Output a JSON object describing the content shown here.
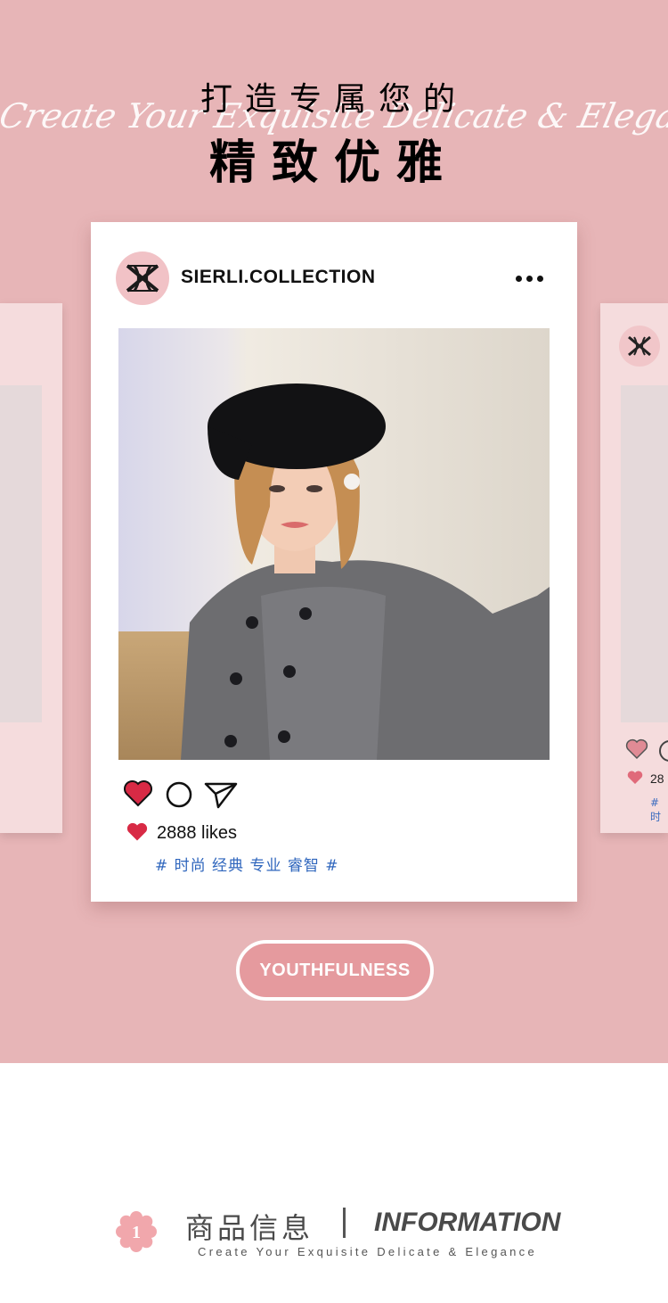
{
  "header": {
    "title_line1": "打造专属您的",
    "title_line2": "精致优雅",
    "script_text": "Create Your Exquisite Delicate & Elegance"
  },
  "post": {
    "handle": "SIERLI.COLLECTION",
    "more_icon": "more-dots-icon",
    "likes": "2888 likes",
    "tags": "# 时尚 经典 专业 睿智 #",
    "icons": [
      "heart-icon",
      "comment-icon",
      "share-icon"
    ]
  },
  "side_card_right": {
    "likes_partial": "28",
    "tag_partial": "# 时"
  },
  "badge": {
    "label": "YOUTHFULNESS"
  },
  "section": {
    "number": "1",
    "title_cn": "商品信息",
    "title_en": "INFORMATION",
    "subtitle": "Create Your Exquisite Delicate & Elegance"
  },
  "colors": {
    "background_pink": "#e7b5b7",
    "heart_red": "#d82a45",
    "tag_blue": "#2f66bd",
    "pill_pink": "#e59a9e"
  }
}
